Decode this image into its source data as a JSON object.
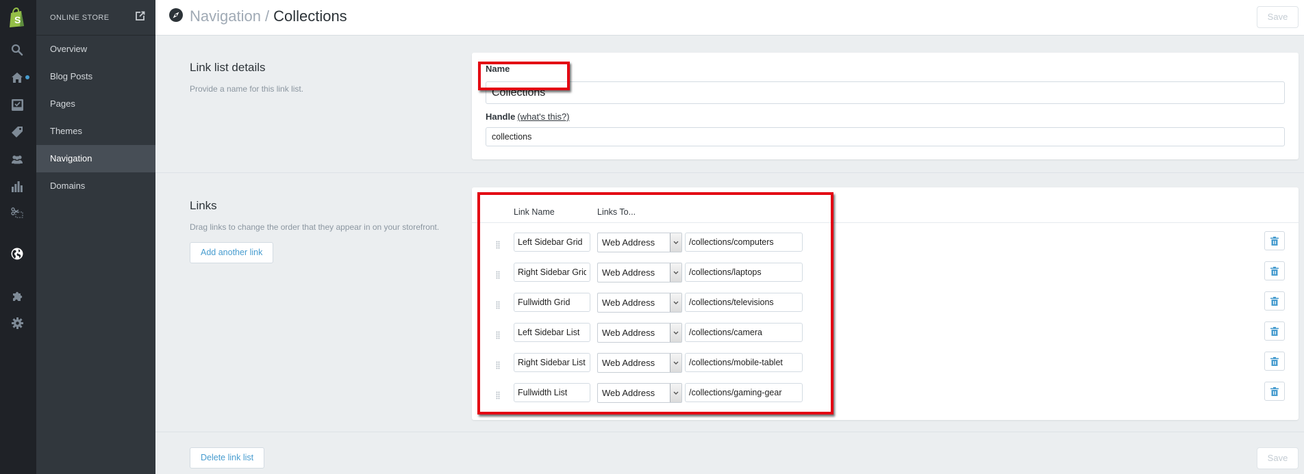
{
  "app": {
    "section_title": "ONLINE STORE",
    "accent_color": "#479ccf",
    "highlight_color": "#e30613"
  },
  "rail": {
    "icons": [
      "shopify-logo-icon",
      "search-icon",
      "home-icon",
      "orders-icon",
      "products-tag-icon",
      "customers-icon",
      "reports-icon",
      "discounts-icon",
      "online-store-globe-icon",
      "apps-puzzle-icon",
      "settings-gear-icon"
    ]
  },
  "sidebar": {
    "items": [
      {
        "label": "Overview",
        "active": false
      },
      {
        "label": "Blog Posts",
        "active": false
      },
      {
        "label": "Pages",
        "active": false
      },
      {
        "label": "Themes",
        "active": false
      },
      {
        "label": "Navigation",
        "active": true
      },
      {
        "label": "Domains",
        "active": false
      }
    ]
  },
  "header": {
    "breadcrumb_parent": "Navigation",
    "breadcrumb_separator": "/",
    "breadcrumb_current": "Collections",
    "save_label": "Save"
  },
  "details": {
    "heading": "Link list details",
    "description": "Provide a name for this link list.",
    "name_label": "Name",
    "name_value": "Collections",
    "handle_label": "Handle",
    "handle_help": "(what's this?)",
    "handle_value": "collections"
  },
  "links": {
    "heading": "Links",
    "description": "Drag links to change the order that they appear in on your storefront.",
    "add_button": "Add another link",
    "col_name": "Link Name",
    "col_target": "Links To...",
    "rows": [
      {
        "name": "Left Sidebar Grid",
        "type": "Web Address",
        "url": "/collections/computers"
      },
      {
        "name": "Right Sidebar Grid",
        "type": "Web Address",
        "url": "/collections/laptops"
      },
      {
        "name": "Fullwidth Grid",
        "type": "Web Address",
        "url": "/collections/televisions"
      },
      {
        "name": "Left Sidebar List",
        "type": "Web Address",
        "url": "/collections/camera"
      },
      {
        "name": "Right Sidebar List",
        "type": "Web Address",
        "url": "/collections/mobile-tablet"
      },
      {
        "name": "Fullwidth List",
        "type": "Web Address",
        "url": "/collections/gaming-gear"
      }
    ]
  },
  "footer": {
    "delete_button": "Delete link list",
    "save_label": "Save"
  }
}
